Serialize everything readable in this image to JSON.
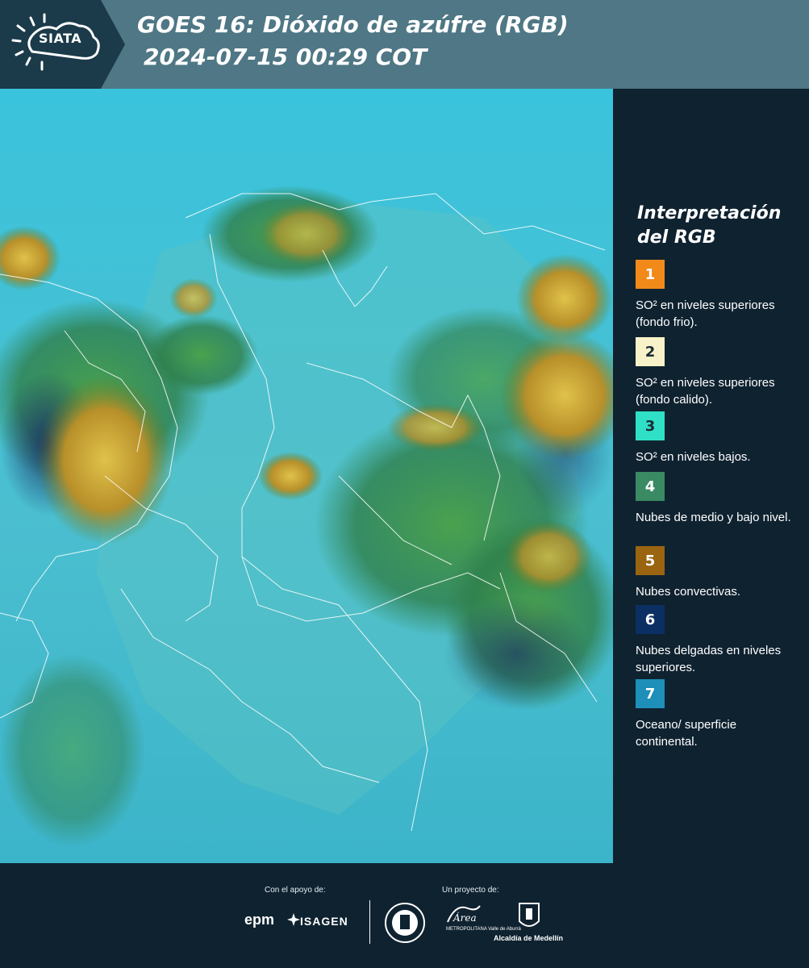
{
  "header": {
    "title_line1": "GOES 16: Dióxido de azúfre (RGB)",
    "title_line2": "2024-07-15 00:29 COT",
    "logo_text": "SIATA",
    "background_color": "#4f7785"
  },
  "legend": {
    "title_line1": "Interpretación",
    "title_line2": "del RGB",
    "items": [
      {
        "number": "1",
        "text": "SO² en niveles superiores (fondo frio).",
        "color": "#f28a1a",
        "text_color": "#ffffff"
      },
      {
        "number": "2",
        "text": "SO² en niveles superiores (fondo calido).",
        "color": "#f7f2c8",
        "text_color": "#1b2b36"
      },
      {
        "number": "3",
        "text": "SO² en niveles bajos.",
        "color": "#2fe0c6",
        "text_color": "#1b2b36"
      },
      {
        "number": "4",
        "text": "Nubes de medio y bajo nivel.",
        "color": "#3a8a64",
        "text_color": "#ffffff"
      },
      {
        "number": "5",
        "text": "Nubes convectivas.",
        "color": "#9a6410",
        "text_color": "#ffffff"
      },
      {
        "number": "6",
        "text": "Nubes delgadas en niveles superiores.",
        "color": "#0c2f63",
        "text_color": "#ffffff"
      },
      {
        "number": "7",
        "text": "Oceano/ superficie continental.",
        "color": "#1d8fb8",
        "text_color": "#ffffff"
      }
    ]
  },
  "footer": {
    "support_label": "Con el apoyo de:",
    "project_label": "Un proyecto de:",
    "sponsor1": "epm",
    "sponsor2": "ISAGEN",
    "partner_metro": "METROPOLITANA Valle de Aburrá",
    "partner_alcaldia": "Alcaldía de Medellín"
  },
  "map": {
    "ocean_color": "#2fb7d4",
    "land_color": "#55c2c9",
    "cloud_green": "#3f9a4c",
    "cloud_yellow": "#c9a531",
    "cloud_dark": "#1c3466",
    "border_color": "#ffffff"
  }
}
